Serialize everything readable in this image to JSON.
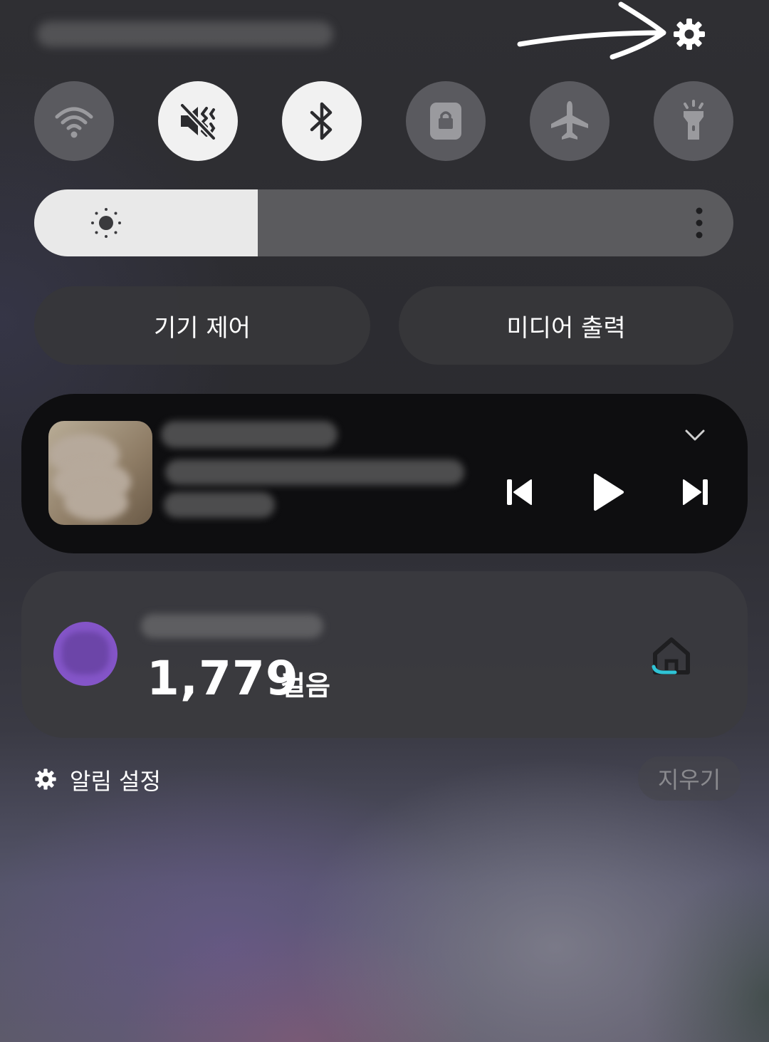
{
  "status_bar": {
    "settings_icon": "gear-icon",
    "annotation": "arrow-icon"
  },
  "quick_toggles": [
    {
      "name": "wifi",
      "icon": "wifi-icon",
      "active": false
    },
    {
      "name": "sound",
      "icon": "vibrate-mute-icon",
      "active": true
    },
    {
      "name": "bluetooth",
      "icon": "bluetooth-icon",
      "active": true
    },
    {
      "name": "secure-folder",
      "icon": "lock-icon",
      "active": false
    },
    {
      "name": "airplane-mode",
      "icon": "airplane-icon",
      "active": false
    },
    {
      "name": "flashlight",
      "icon": "flashlight-icon",
      "active": false
    }
  ],
  "brightness": {
    "level": 0.32,
    "icon": "sun-icon",
    "more_icon": "more-vertical-icon"
  },
  "buttons": {
    "device_control": "기기 제어",
    "media_output": "미디어 출력"
  },
  "media": {
    "controls": [
      "previous-icon",
      "play-icon",
      "next-icon"
    ],
    "expand_icon": "chevron-down-icon"
  },
  "steps": {
    "count": "1,779",
    "unit": "걸음",
    "icon": "home-icon"
  },
  "footer": {
    "notification_settings": "알림 설정",
    "clear": "지우기"
  },
  "colors": {
    "toggle_on": "#f1f1f1",
    "toggle_off": "#5f5f64",
    "avatar": "#8455c8",
    "accent": "#2fc4d6"
  }
}
